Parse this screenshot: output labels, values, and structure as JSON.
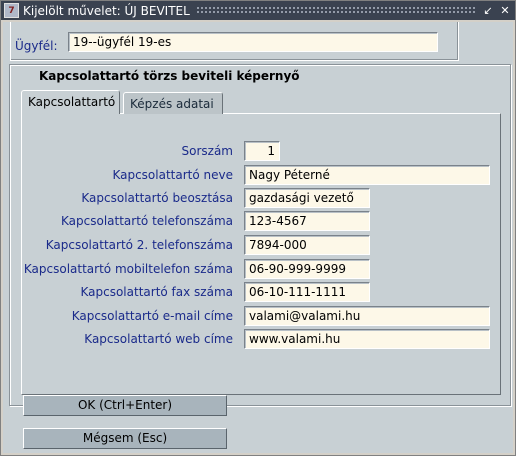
{
  "window": {
    "title": "Kijelölt művelet: ÚJ BEVITEL",
    "icon_label": "7"
  },
  "titlebar_buttons": {
    "restore_glyph": "↙",
    "close_glyph": "✕"
  },
  "header": {
    "ugyfel_label": "Ügyfél:",
    "ugyfel_value": "19--ügyfél 19-es"
  },
  "group": {
    "title": "Kapcsolattartó törzs beviteli képernyő"
  },
  "tabs": [
    {
      "label": "Kapcsolattartó",
      "active": true
    },
    {
      "label": "Képzés adatai",
      "active": false
    }
  ],
  "form": {
    "rows": [
      {
        "label": "Sorszám",
        "value": "1"
      },
      {
        "label": "Kapcsolattartó neve",
        "value": "Nagy Péterné"
      },
      {
        "label": "Kapcsolattartó beosztása",
        "value": "gazdasági vezető"
      },
      {
        "label": "Kapcsolattartó telefonszáma",
        "value": "123-4567"
      },
      {
        "label": "Kapcsolattartó 2. telefonszáma",
        "value": "7894-000"
      },
      {
        "label": "Kapcsolattartó mobiltelefon száma",
        "value": "06-90-999-9999"
      },
      {
        "label": "Kapcsolattartó fax száma",
        "value": "06-10-111-1111"
      },
      {
        "label": "Kapcsolattartó e-mail címe",
        "value": "valami@valami.hu"
      },
      {
        "label": "Kapcsolattartó web címe",
        "value": "www.valami.hu"
      }
    ]
  },
  "buttons": {
    "ok_label": "OK (Ctrl+Enter)",
    "cancel_label": "Mégsem (Esc)"
  },
  "colors": {
    "titlebar": "#3a4250",
    "background": "#c8d0d4",
    "label_text": "#1a2a8a",
    "field_bg": "#fdf8e8",
    "button_bg": "#a8b4bc"
  }
}
